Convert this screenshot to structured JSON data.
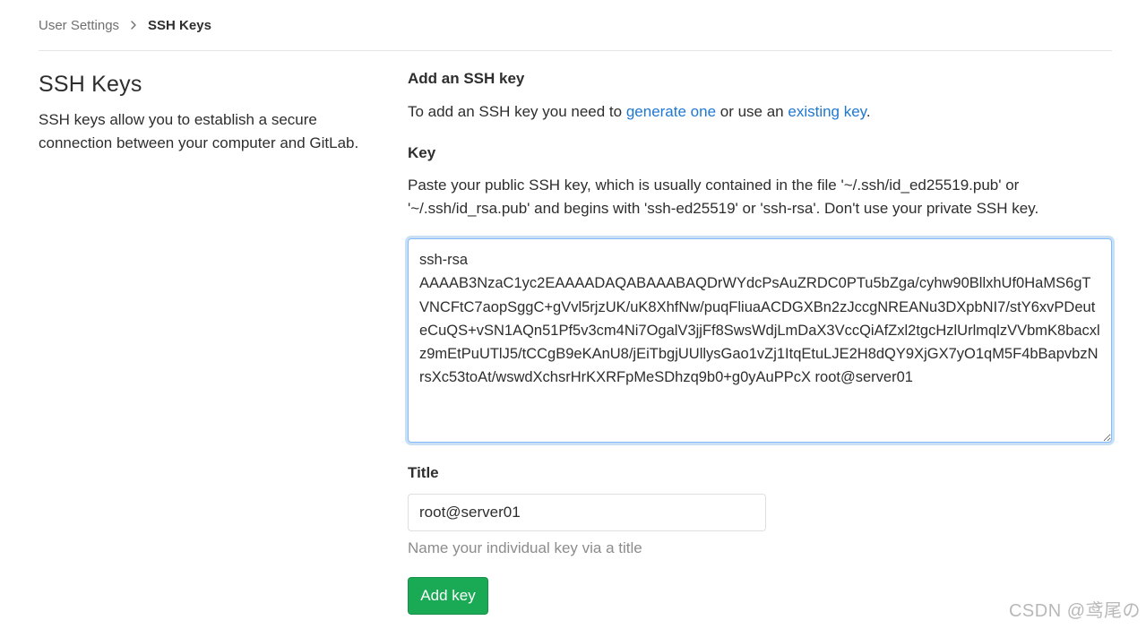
{
  "breadcrumb": {
    "parent": "User Settings",
    "current": "SSH Keys",
    "separator_icon": "chevron-right-icon"
  },
  "sidebar": {
    "title": "SSH Keys",
    "description": "SSH keys allow you to establish a secure connection between your computer and GitLab."
  },
  "form": {
    "heading": "Add an SSH key",
    "intro_before": "To add an SSH key you need to ",
    "generate_link": "generate one",
    "intro_middle": " or use an ",
    "existing_link": "existing key",
    "intro_after": ".",
    "key_label": "Key",
    "key_help": "Paste your public SSH key, which is usually contained in the file '~/.ssh/id_ed25519.pub' or '~/.ssh/id_rsa.pub' and begins with 'ssh-ed25519' or 'ssh-rsa'. Don't use your private SSH key.",
    "key_value": "ssh-rsa\nAAAAB3NzaC1yc2EAAAADAQABAAABAQDrWYdcPsAuZRDC0PTu5bZga/cyhw90BllxhUf0HaMS6gTVNCFtC7aopSggC+gVvl5rjzUK/uK8XhfNw/puqFliuaACDGXBn2zJccgNREANu3DXpbNI7/stY6xvPDeuteCuQS+vSN1AQn51Pf5v3cm4Ni7OgalV3jjFf8SwsWdjLmDaX3VccQiAfZxl2tgcHzlUrlmqlzVVbmK8bacxlz9mEtPuUTlJ5/tCCgB9eKAnU8/jEiTbgjUUllysGao1vZj1ItqEtuLJE2H8dQY9XjGX7yO1qM5F4bBapvbzNrsXc53toAt/wswdXchsrHrKXRFpMeSDhzq9b0+g0yAuPPcX root@server01",
    "title_label": "Title",
    "title_value": "root@server01",
    "title_help": "Name your individual key via a title",
    "submit_label": "Add key"
  },
  "colors": {
    "link": "#1f78d1",
    "submit": "#1aaa55",
    "focus_border": "#80bdff"
  },
  "watermark": "CSDN @鸢尾の"
}
